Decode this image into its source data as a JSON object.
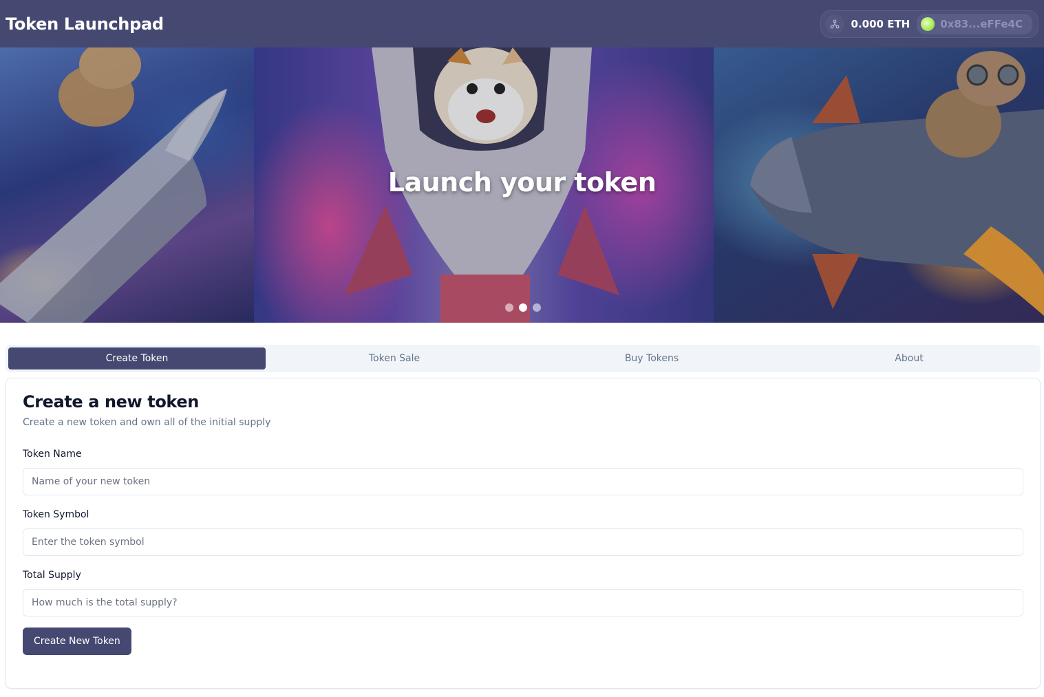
{
  "header": {
    "title": "Token Launchpad",
    "wallet": {
      "chain_icon": "network-icon",
      "balance": "0.000 ETH",
      "account": "0x83...eFFe4C"
    }
  },
  "hero": {
    "title": "Launch your token",
    "slides": 3,
    "active_slide": 2
  },
  "tabs": [
    {
      "label": "Create Token",
      "active": true
    },
    {
      "label": "Token Sale",
      "active": false
    },
    {
      "label": "Buy Tokens",
      "active": false
    },
    {
      "label": "About",
      "active": false
    }
  ],
  "form": {
    "title": "Create a new token",
    "description": "Create a new token and own all of the initial supply",
    "fields": [
      {
        "label": "Token Name",
        "placeholder": "Name of your new token",
        "value": ""
      },
      {
        "label": "Token Symbol",
        "placeholder": "Enter the token symbol",
        "value": ""
      },
      {
        "label": "Total Supply",
        "placeholder": "How much is the total supply?",
        "value": ""
      }
    ],
    "submit_label": "Create New Token"
  },
  "colors": {
    "primary": "#454870",
    "background": "#ffffff",
    "muted_text": "#64748b",
    "border": "#e2e8f0"
  }
}
